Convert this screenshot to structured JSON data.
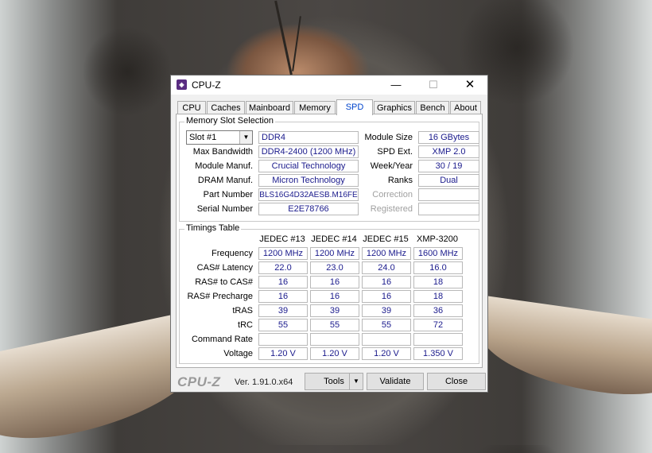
{
  "window": {
    "title": "CPU-Z",
    "icon": "cpu-z-app-icon",
    "min_glyph": "—",
    "max_glyph": "☐",
    "close_glyph": "✕"
  },
  "tabs": [
    {
      "label": "CPU"
    },
    {
      "label": "Caches"
    },
    {
      "label": "Mainboard"
    },
    {
      "label": "Memory"
    },
    {
      "label": "SPD",
      "active": true
    },
    {
      "label": "Graphics"
    },
    {
      "label": "Bench"
    },
    {
      "label": "About"
    }
  ],
  "slot": {
    "title": "Memory Slot Selection",
    "selected": "Slot #1",
    "type": "DDR4",
    "labels": {
      "max_bandwidth": "Max Bandwidth",
      "module_manuf": "Module Manuf.",
      "dram_manuf": "DRAM Manuf.",
      "part_number": "Part Number",
      "serial_number": "Serial Number",
      "module_size": "Module Size",
      "spd_ext": "SPD Ext.",
      "week_year": "Week/Year",
      "ranks": "Ranks",
      "correction": "Correction",
      "registered": "Registered"
    },
    "values": {
      "max_bandwidth": "DDR4-2400 (1200 MHz)",
      "module_manuf": "Crucial Technology",
      "dram_manuf": "Micron Technology",
      "part_number": "BLS16G4D32AESB.M16FE",
      "serial_number": "E2E78766",
      "module_size": "16 GBytes",
      "spd_ext": "XMP 2.0",
      "week_year": "30 / 19",
      "ranks": "Dual",
      "correction": "",
      "registered": ""
    }
  },
  "timings": {
    "title": "Timings Table",
    "columns": [
      "JEDEC #13",
      "JEDEC #14",
      "JEDEC #15",
      "XMP-3200"
    ],
    "rows": [
      {
        "label": "Frequency",
        "values": [
          "1200 MHz",
          "1200 MHz",
          "1200 MHz",
          "1600 MHz"
        ]
      },
      {
        "label": "CAS# Latency",
        "values": [
          "22.0",
          "23.0",
          "24.0",
          "16.0"
        ]
      },
      {
        "label": "RAS# to CAS#",
        "values": [
          "16",
          "16",
          "16",
          "18"
        ]
      },
      {
        "label": "RAS# Precharge",
        "values": [
          "16",
          "16",
          "16",
          "18"
        ]
      },
      {
        "label": "tRAS",
        "values": [
          "39",
          "39",
          "39",
          "36"
        ]
      },
      {
        "label": "tRC",
        "values": [
          "55",
          "55",
          "55",
          "72"
        ]
      },
      {
        "label": "Command Rate",
        "values": [
          "",
          "",
          "",
          ""
        ]
      },
      {
        "label": "Voltage",
        "values": [
          "1.20 V",
          "1.20 V",
          "1.20 V",
          "1.350 V"
        ]
      }
    ]
  },
  "footer": {
    "brand": "CPU-Z",
    "version": "Ver. 1.91.0.x64",
    "tools_label": "Tools",
    "validate_label": "Validate",
    "close_label": "Close"
  }
}
